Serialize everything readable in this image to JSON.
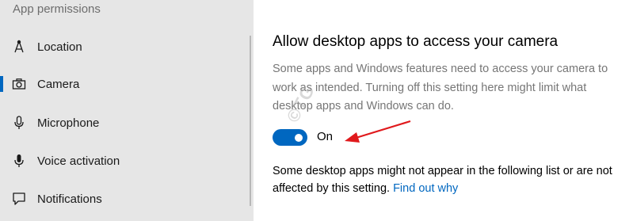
{
  "sidebar": {
    "header": "App permissions",
    "items": [
      {
        "label": "Location",
        "icon": "location-icon",
        "selected": false
      },
      {
        "label": "Camera",
        "icon": "camera-icon",
        "selected": true
      },
      {
        "label": "Microphone",
        "icon": "microphone-icon",
        "selected": false
      },
      {
        "label": "Voice activation",
        "icon": "voice-activation-icon",
        "selected": false
      },
      {
        "label": "Notifications",
        "icon": "notifications-icon",
        "selected": false
      }
    ]
  },
  "main": {
    "title": "Allow desktop apps to access your camera",
    "description": "Some apps and Windows features need to access your camera to work as intended. Turning off this setting here might limit what desktop apps and Windows can do.",
    "toggle": {
      "state": "on",
      "label": "On"
    },
    "note": {
      "text": "Some desktop apps might not appear in the following list or are not affected by this setting.",
      "link": "Find out why"
    }
  },
  "watermark": "©TG",
  "colors": {
    "accent": "#0067c0",
    "sidebar_bg": "#e6e6e6",
    "annotation_arrow": "#e0191c"
  }
}
